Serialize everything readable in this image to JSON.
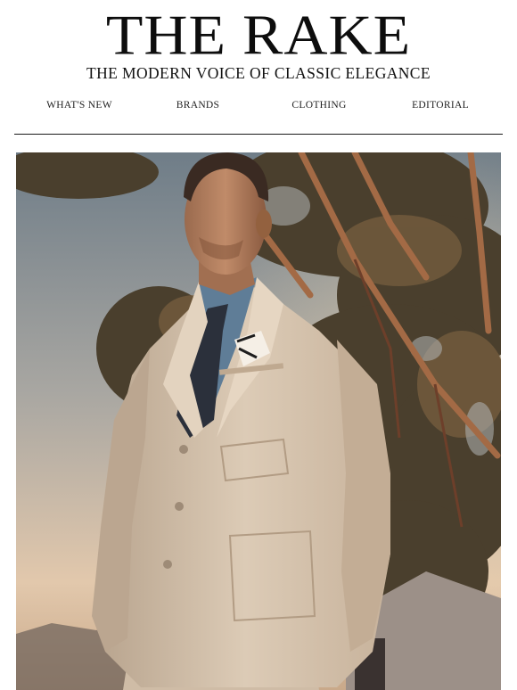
{
  "masthead": {
    "logo": "THE RAKE",
    "tagline": "THE MODERN VOICE OF CLASSIC ELEGANCE"
  },
  "nav": {
    "items": [
      {
        "label": "WHAT'S NEW"
      },
      {
        "label": "BRANDS"
      },
      {
        "label": "CLOTHING"
      },
      {
        "label": "EDITORIAL"
      }
    ]
  },
  "hero": {
    "description_icon": "hero-photo",
    "colors": {
      "sky_top": "#7d8a94",
      "sky_bottom": "#e9d2b8",
      "foliage": "#4e4230",
      "jacket": "#d8c7b2",
      "shirt": "#5d7c96",
      "tie": "#2a2f3a"
    }
  }
}
